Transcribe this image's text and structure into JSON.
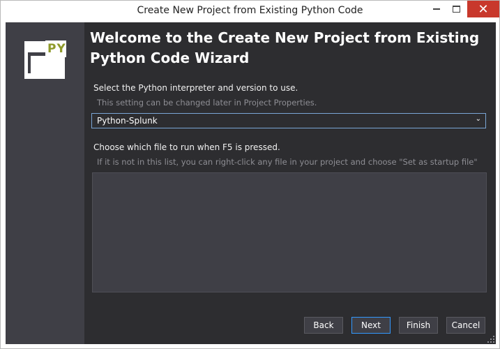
{
  "window": {
    "title": "Create New Project from Existing Python Code",
    "close_glyph": "✕"
  },
  "sidebar": {
    "logo_text": "PY"
  },
  "wizard": {
    "heading": "Welcome to the Create New Project from Existing Python Code Wizard",
    "interpreter_label": "Select the Python interpreter and version to use.",
    "interpreter_hint": "This setting can be changed later in Project Properties.",
    "interpreter_value": "Python-Splunk",
    "interpreter_chevron": "⌄",
    "startup_label": "Choose which file to run when F5 is pressed.",
    "startup_hint": "If it is not in this list, you can right-click any file in your project and choose \"Set as startup file\""
  },
  "buttons": {
    "back": "Back",
    "next": "Next",
    "finish": "Finish",
    "cancel": "Cancel"
  },
  "colors": {
    "panel": "#2d2d30",
    "sidebar": "#3f3f46",
    "accent": "#3399ff",
    "logo_text": "#8f9a2b",
    "close": "#c8382c"
  }
}
